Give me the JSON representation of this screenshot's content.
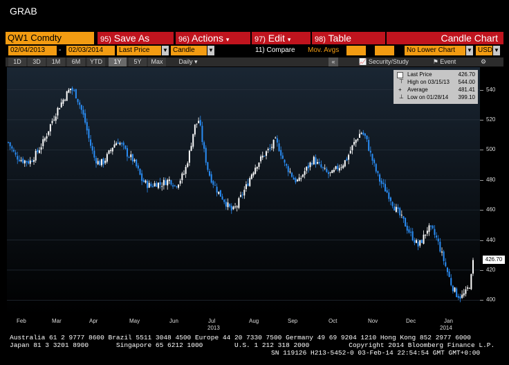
{
  "title": "GRAB",
  "toolbar": {
    "ticker": "QW1 Comdty",
    "buttons": [
      {
        "num": "95)",
        "label": "Save As"
      },
      {
        "num": "96)",
        "label": "Actions"
      },
      {
        "num": "97)",
        "label": "Edit"
      },
      {
        "num": "98)",
        "label": "Table"
      }
    ],
    "chart_type_title": "Candle Chart",
    "start_date": "02/04/2013",
    "end_date": "02/03/2014",
    "price_field": "Last Price",
    "style": "Candle",
    "compare": "11) Compare",
    "mov_avgs": "Mov. Avgs",
    "lower_chart": "No Lower Chart",
    "currency": "USD",
    "periods": [
      "1D",
      "3D",
      "1M",
      "6M",
      "YTD",
      "1Y",
      "5Y",
      "Max"
    ],
    "active_period": "1Y",
    "frequency": "Daily",
    "security_study": "Security/Study",
    "event": "Event"
  },
  "legend": {
    "last_label": "Last Price",
    "last_value": "426.70",
    "high_label": "High on 03/15/13",
    "high_value": "544.00",
    "avg_label": "Average",
    "avg_value": "481.41",
    "low_label": "Low on 01/28/14",
    "low_value": "399.10"
  },
  "footer": {
    "line1": "Australia 61 2 9777 8600 Brazil 5511 3048 4500 Europe 44 20 7330 7500 Germany 49 69 9204 1210 Hong Kong 852 2977 6000",
    "line2": "Japan 81 3 3201 8900       Singapore 65 6212 1000        U.S. 1 212 318 2000          Copyright 2014 Bloomberg Finance L.P.",
    "line3": "SN 119126 H213-5452-0 03-Feb-14 22:54:54 GMT GMT+0:00"
  },
  "colors": {
    "up": "#ffffff",
    "down": "#2a8df5",
    "bg_top": "#1a2633",
    "bg_bottom": "#000000",
    "accent": "#f39c12",
    "button_red": "#c0141e"
  },
  "chart_data": {
    "type": "candlestick",
    "title": "",
    "ylim": [
      390,
      555
    ],
    "yticks": [
      400,
      420,
      440,
      460,
      480,
      500,
      520,
      540
    ],
    "x_labels": [
      "Feb",
      "Mar",
      "Apr",
      "May",
      "Jun",
      "Jul",
      "Aug",
      "Sep",
      "Oct",
      "Nov",
      "Dec",
      "Jan"
    ],
    "year_labels": [
      "2013",
      "2014"
    ],
    "last_price": 426.7,
    "path": [
      [
        0,
        505
      ],
      [
        3,
        496
      ],
      [
        6,
        493
      ],
      [
        9,
        492
      ],
      [
        12,
        498
      ],
      [
        15,
        506
      ],
      [
        18,
        518
      ],
      [
        21,
        528
      ],
      [
        24,
        536
      ],
      [
        26,
        541
      ],
      [
        28,
        538
      ],
      [
        30,
        530
      ],
      [
        32,
        520
      ],
      [
        34,
        506
      ],
      [
        36,
        495
      ],
      [
        38,
        491
      ],
      [
        40,
        492
      ],
      [
        42,
        497
      ],
      [
        44,
        503
      ],
      [
        46,
        506
      ],
      [
        48,
        502
      ],
      [
        50,
        497
      ],
      [
        52,
        494
      ],
      [
        54,
        488
      ],
      [
        56,
        480
      ],
      [
        58,
        477
      ],
      [
        60,
        476
      ],
      [
        62,
        478
      ],
      [
        64,
        477
      ],
      [
        66,
        479
      ],
      [
        68,
        480
      ],
      [
        70,
        476
      ],
      [
        72,
        480
      ],
      [
        74,
        485
      ],
      [
        76,
        498
      ],
      [
        78,
        515
      ],
      [
        80,
        520
      ],
      [
        82,
        500
      ],
      [
        84,
        485
      ],
      [
        86,
        478
      ],
      [
        88,
        472
      ],
      [
        90,
        468
      ],
      [
        92,
        463
      ],
      [
        94,
        459
      ],
      [
        96,
        463
      ],
      [
        98,
        470
      ],
      [
        100,
        476
      ],
      [
        102,
        484
      ],
      [
        104,
        490
      ],
      [
        106,
        494
      ],
      [
        108,
        498
      ],
      [
        110,
        501
      ],
      [
        112,
        506
      ],
      [
        114,
        500
      ],
      [
        116,
        490
      ],
      [
        118,
        486
      ],
      [
        120,
        480
      ],
      [
        122,
        479
      ],
      [
        124,
        485
      ],
      [
        126,
        489
      ],
      [
        128,
        494
      ],
      [
        130,
        490
      ],
      [
        132,
        487
      ],
      [
        134,
        484
      ],
      [
        136,
        484
      ],
      [
        138,
        488
      ],
      [
        140,
        490
      ],
      [
        142,
        494
      ],
      [
        144,
        501
      ],
      [
        146,
        507
      ],
      [
        148,
        512
      ],
      [
        150,
        508
      ],
      [
        152,
        497
      ],
      [
        154,
        487
      ],
      [
        156,
        479
      ],
      [
        158,
        474
      ],
      [
        160,
        469
      ],
      [
        162,
        462
      ],
      [
        164,
        457
      ],
      [
        166,
        452
      ],
      [
        168,
        446
      ],
      [
        170,
        441
      ],
      [
        172,
        436
      ],
      [
        174,
        441
      ],
      [
        176,
        448
      ],
      [
        178,
        446
      ],
      [
        180,
        440
      ],
      [
        182,
        430
      ],
      [
        184,
        420
      ],
      [
        186,
        410
      ],
      [
        188,
        404
      ],
      [
        190,
        402
      ],
      [
        192,
        405
      ],
      [
        194,
        412
      ],
      [
        195,
        426.7
      ]
    ]
  }
}
